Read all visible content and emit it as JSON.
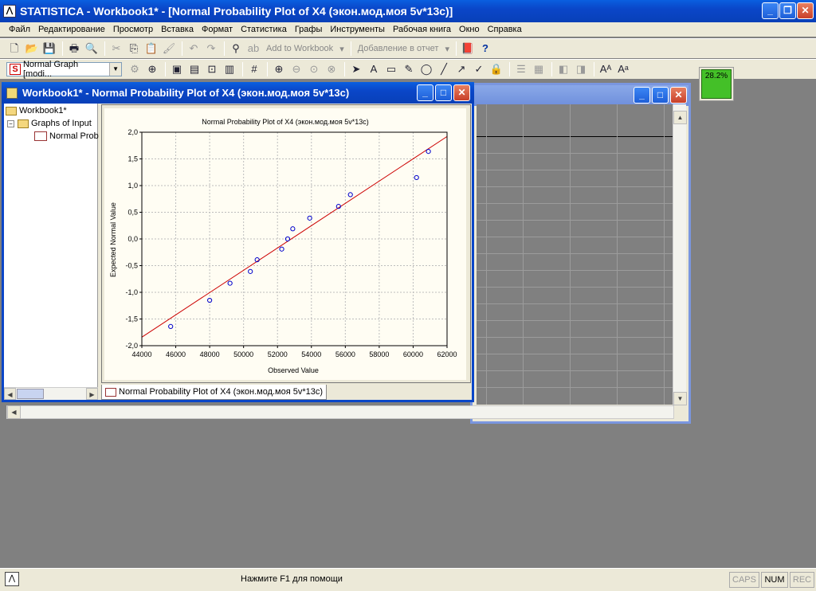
{
  "app": {
    "title": "STATISTICA - Workbook1* - [Normal Probability Plot of X4 (экон.мод.моя 5v*13c)]",
    "icon": "statistica-logo-icon"
  },
  "menu": [
    "Файл",
    "Редактирование",
    "Просмотр",
    "Вставка",
    "Формат",
    "Статистика",
    "Графы",
    "Инструменты",
    "Рабочая книга",
    "Окно",
    "Справка"
  ],
  "toolbar1": {
    "add_to_workbook": "Add to Workbook",
    "add_to_report": "Добавление в отчет"
  },
  "toolbar2": {
    "graph_type": "Normal Graph [modi..."
  },
  "progress": {
    "value": "28.2%",
    "fraction": 0.282
  },
  "child_window": {
    "title": "Workbook1* - Normal Probability Plot of X4 (экон.мод.моя 5v*13c)"
  },
  "tree": {
    "root": "Workbook1*",
    "group": "Graphs of Input",
    "item": "Normal Prob"
  },
  "tab": {
    "label": "Normal Probability Plot of X4 (экон.мод.моя 5v*13c)"
  },
  "status": {
    "message": "Нажмите F1 для помощи",
    "indicators": [
      "CAPS",
      "NUM",
      "REC"
    ],
    "active": "NUM"
  },
  "chart_data": {
    "type": "scatter",
    "title": "Normal Probability Plot of X4 (экон.мод.моя 5v*13c)",
    "xlabel": "Observed Value",
    "ylabel": "Expected Normal Value",
    "xlim": [
      44000,
      62000
    ],
    "ylim": [
      -2.0,
      2.0
    ],
    "xticks": [
      "44000",
      "46000",
      "48000",
      "50000",
      "52000",
      "54000",
      "56000",
      "58000",
      "60000",
      "62000"
    ],
    "yticks": [
      "2,0",
      "1,5",
      "1,0",
      "0,5",
      "0,0",
      "-0,5",
      "-1,0",
      "-1,5",
      "-2,0"
    ],
    "grid": true,
    "points": [
      [
        45700,
        -1.64
      ],
      [
        48000,
        -1.15
      ],
      [
        49200,
        -0.83
      ],
      [
        50400,
        -0.61
      ],
      [
        50800,
        -0.39
      ],
      [
        52250,
        -0.19
      ],
      [
        52600,
        0.0
      ],
      [
        52900,
        0.19
      ],
      [
        53900,
        0.39
      ],
      [
        55600,
        0.61
      ],
      [
        56300,
        0.83
      ],
      [
        60200,
        1.15
      ],
      [
        60900,
        1.64
      ]
    ],
    "fit_line": [
      [
        44000,
        -1.84
      ],
      [
        62000,
        1.92
      ]
    ],
    "point_color": "#0000cc",
    "line_color": "#cc0000"
  }
}
